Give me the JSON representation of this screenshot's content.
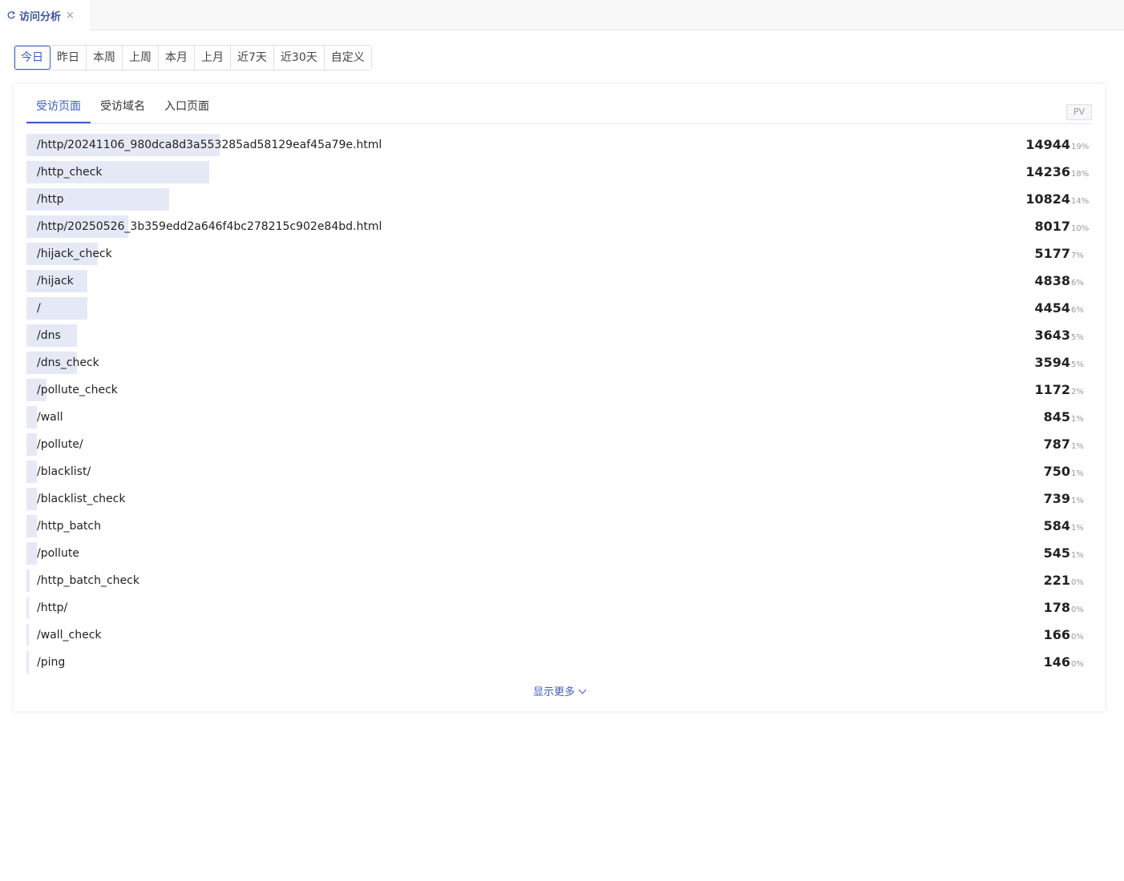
{
  "page_tab": {
    "label": "访问分析",
    "close": "×"
  },
  "date_range": {
    "selected": "今日",
    "options": [
      "今日",
      "昨日",
      "本周",
      "上周",
      "本月",
      "上月",
      "近7天",
      "近30天",
      "自定义"
    ]
  },
  "card": {
    "tabs": [
      "受访页面",
      "受访域名",
      "入口页面"
    ],
    "active_tab": "受访页面",
    "metric_badge": "PV",
    "accent_color": "#3b5cc4",
    "bar_color": "#e5e9f6",
    "rows": [
      {
        "path": "/http/20241106_980dca8d3a553285ad58129eaf45a79e.html",
        "count": "14944",
        "percent": "19%",
        "share": 19
      },
      {
        "path": "/http_check",
        "count": "14236",
        "percent": "18%",
        "share": 18
      },
      {
        "path": "/http",
        "count": "10824",
        "percent": "14%",
        "share": 14
      },
      {
        "path": "/http/20250526_3b359edd2a646f4bc278215c902e84bd.html",
        "count": "8017",
        "percent": "10%",
        "share": 10
      },
      {
        "path": "/hijack_check",
        "count": "5177",
        "percent": "7%",
        "share": 7
      },
      {
        "path": "/hijack",
        "count": "4838",
        "percent": "6%",
        "share": 6
      },
      {
        "path": "/",
        "count": "4454",
        "percent": "6%",
        "share": 6
      },
      {
        "path": "/dns",
        "count": "3643",
        "percent": "5%",
        "share": 5
      },
      {
        "path": "/dns_check",
        "count": "3594",
        "percent": "5%",
        "share": 5
      },
      {
        "path": "/pollute_check",
        "count": "1172",
        "percent": "2%",
        "share": 2
      },
      {
        "path": "/wall",
        "count": "845",
        "percent": "1%",
        "share": 1
      },
      {
        "path": "/pollute/",
        "count": "787",
        "percent": "1%",
        "share": 1
      },
      {
        "path": "/blacklist/",
        "count": "750",
        "percent": "1%",
        "share": 1
      },
      {
        "path": "/blacklist_check",
        "count": "739",
        "percent": "1%",
        "share": 1
      },
      {
        "path": "/http_batch",
        "count": "584",
        "percent": "1%",
        "share": 1
      },
      {
        "path": "/pollute",
        "count": "545",
        "percent": "1%",
        "share": 1
      },
      {
        "path": "/http_batch_check",
        "count": "221",
        "percent": "0%",
        "share": 0.3
      },
      {
        "path": "/http/",
        "count": "178",
        "percent": "0%",
        "share": 0.2
      },
      {
        "path": "/wall_check",
        "count": "166",
        "percent": "0%",
        "share": 0.2
      },
      {
        "path": "/ping",
        "count": "146",
        "percent": "0%",
        "share": 0.2
      }
    ],
    "show_more": "显示更多"
  }
}
